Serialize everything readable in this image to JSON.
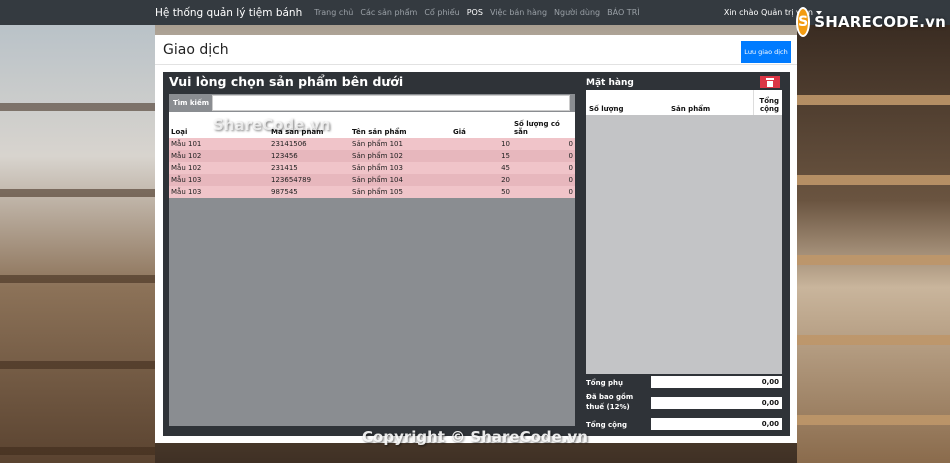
{
  "navbar": {
    "brand": "Hệ thống quản lý tiệm bánh",
    "items": [
      {
        "label": "Trang chủ",
        "active": false
      },
      {
        "label": "Các sản phẩm",
        "active": false
      },
      {
        "label": "Cổ phiếu",
        "active": false
      },
      {
        "label": "POS",
        "active": true
      },
      {
        "label": "Việc bán hàng",
        "active": false
      },
      {
        "label": "Người dùng",
        "active": false
      },
      {
        "label": "BÁO TRÌ",
        "active": false
      }
    ],
    "user_greeting": "Xin chào Quản trị viên"
  },
  "logo": {
    "text": "SHARECODE.vn"
  },
  "page": {
    "title": "Giao dịch",
    "save_label": "Lưu giao dịch"
  },
  "products": {
    "title": "Vui lòng chọn sản phẩm bên dưới",
    "search_label": "Tìm kiếm",
    "search_value": "",
    "columns": [
      "Loại",
      "Mã sản phẩm",
      "Tên sản phẩm",
      "Giá",
      "Số lượng có sẵn"
    ],
    "rows": [
      {
        "loai": "Mẫu 101",
        "ma": "23141506",
        "ten": "Sản phẩm 101",
        "gia": "10",
        "so_luong": "0"
      },
      {
        "loai": "Mẫu 102",
        "ma": "123456",
        "ten": "Sản phẩm 102",
        "gia": "15",
        "so_luong": "0"
      },
      {
        "loai": "Mẫu 102",
        "ma": "231415",
        "ten": "Sản phẩm 103",
        "gia": "45",
        "so_luong": "0"
      },
      {
        "loai": "Mẫu 103",
        "ma": "123654789",
        "ten": "Sản phẩm 104",
        "gia": "20",
        "so_luong": "0"
      },
      {
        "loai": "Mẫu 103",
        "ma": "987545",
        "ten": "Sản phẩm 105",
        "gia": "50",
        "so_luong": "0"
      }
    ]
  },
  "cart": {
    "title": "Mặt hàng",
    "columns": [
      "Số lượng",
      "Sản phẩm",
      "Tổng cộng"
    ],
    "subtotal_label": "Tổng phụ",
    "subtotal_value": "0,00",
    "tax_label": "Đã bao gồm thuế (12%)",
    "tax_value": "0,00",
    "total_label": "Tổng cộng",
    "total_value": "0,00"
  },
  "watermarks": {
    "bottom": "Copyright © ShareCode.vn",
    "middle": "ShareCode.vn"
  }
}
